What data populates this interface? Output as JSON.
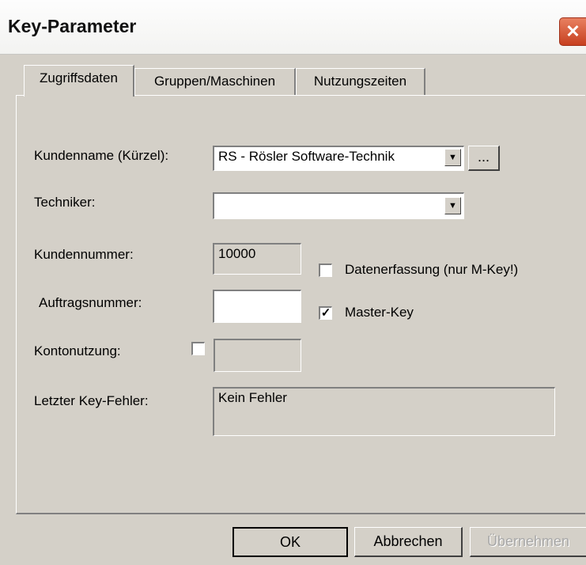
{
  "window": {
    "title": "Key-Parameter",
    "close_glyph": "✕"
  },
  "tabs": [
    {
      "label": "Zugriffsdaten",
      "active": true
    },
    {
      "label": "Gruppen/Maschinen",
      "active": false
    },
    {
      "label": "Nutzungszeiten",
      "active": false
    }
  ],
  "form": {
    "kundenname_label": "Kundenname (Kürzel):",
    "kundenname_value": "RS - Rösler Software-Technik",
    "browse_label": "...",
    "techniker_label": "Techniker:",
    "techniker_value": "",
    "kundennummer_label": "Kundennummer:",
    "kundennummer_value": "10000",
    "datenerfassung_label": "Datenerfassung (nur M-Key!)",
    "datenerfassung_checked": false,
    "auftragsnummer_label": "Auftragsnummer:",
    "auftragsnummer_value": "",
    "masterkey_label": "Master-Key",
    "masterkey_checked": true,
    "kontonutzung_label": "Kontonutzung:",
    "kontonutzung_checked": false,
    "kontonutzung_value": "",
    "fehler_label": "Letzter Key-Fehler:",
    "fehler_value": "Kein Fehler"
  },
  "buttons": {
    "ok": "OK",
    "cancel": "Abbrechen",
    "apply": "Übernehmen"
  },
  "icons": {
    "dropdown": "▼",
    "check": "✓"
  }
}
